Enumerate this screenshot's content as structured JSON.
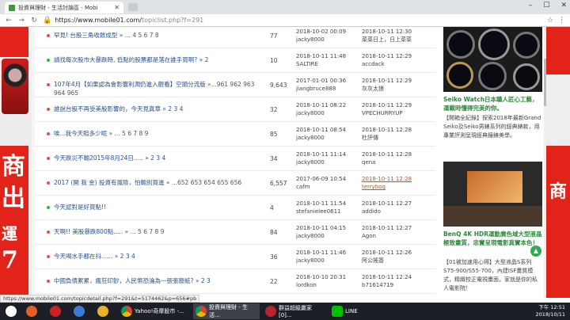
{
  "browser": {
    "tab_title": "投資與理財 - 生活討論區 - Mobi",
    "url_host": "https://www.mobile01.com/",
    "url_path": "topiclist.php?f=291"
  },
  "ad_left_text": [
    "商",
    "出",
    "運",
    "7"
  ],
  "topics": [
    {
      "title": "罕見! 台股三角收斂成型 »",
      "pages": "... 4 5 6 7 8",
      "count": "77",
      "start_date": "2018-10-02 00:09",
      "start_user": "jacky8000",
      "last_date": "2018-10-11 12:30",
      "last_user": "菜菜日上，日上菜菜",
      "dot_color": "#d9534f"
    },
    {
      "title": "請找每次股市大暴跌時, 低點的股票都是落在誰手買啊? » 2",
      "pages": "",
      "count": "10",
      "start_date": "2018-10-11 11:48",
      "start_user": "SALTIRE",
      "last_date": "2018-10-11 12:29",
      "last_user": "accdack",
      "dot_color": "#3fae49"
    },
    {
      "title": "107年4月【如果認為會影響利潤仍進入觀看】空頭分流版",
      "pages": "»...961 962 963 964 965",
      "count": "9,643",
      "start_date": "2017-01-01 00:36",
      "start_user": "jiangbruce888",
      "last_date": "2018-10-11 12:29",
      "last_user": "灰灰太狼",
      "dot_color": "#d9534f"
    },
    {
      "title": "誰說台股不再受美股影響的，今天見真章 » 2 3 4",
      "pages": "",
      "count": "32",
      "start_date": "2018-10-11 08:22",
      "start_user": "jacky8000",
      "last_date": "2018-10-11 12:29",
      "last_user": "VPECHURRYUP",
      "dot_color": "#d9534f"
    },
    {
      "title": "唉...我今天賠多少呢 »",
      "pages": "... 5 6 7 8 9",
      "count": "85",
      "start_date": "2018-10-11 08:54",
      "start_user": "jacky8000",
      "last_date": "2018-10-11 12:28",
      "last_user": "杜評傳",
      "dot_color": "#d9534f"
    },
    {
      "title": "今天跌災不輸2015年8月24日..... » 2 3 4",
      "pages": "",
      "count": "34",
      "start_date": "2018-10-11 11:14",
      "start_user": "jacky8000",
      "last_date": "2018-10-11 12:28",
      "last_user": "qena",
      "dot_color": "#d9534f"
    },
    {
      "title": "2017 (開 我 金) 投資有風險，怕輸別買進 »",
      "pages": "...652 653 654 655 656",
      "count": "6,557",
      "start_date": "2017-06-09 10:54",
      "start_user": "cafm",
      "last_date": "2018-10-11 12:28",
      "last_user": "terrybog",
      "dot_color": "#d9534f",
      "last_link": true
    },
    {
      "title": "今天認對是好買點!!",
      "pages": "",
      "count": "4",
      "start_date": "2018-10-11 11:54",
      "start_user": "stefanielee0611",
      "last_date": "2018-10-11 12:27",
      "last_user": "addido",
      "dot_color": "#3fae49"
    },
    {
      "title": "天啊!! 美股暴跌800點..... »",
      "pages": "... 5 6 7 8 9",
      "count": "84",
      "start_date": "2018-10-11 04:15",
      "start_user": "jacky8000",
      "last_date": "2018-10-11 12:27",
      "last_user": "Agon",
      "dot_color": "#d9534f"
    },
    {
      "title": "今天喝水手都在抖...... » 2 3 4",
      "pages": "",
      "count": "36",
      "start_date": "2018-10-11 11:46",
      "start_user": "jacky8000",
      "last_date": "2018-10-11 12:26",
      "last_user": "阿公搖簽",
      "dot_color": "#d9534f"
    },
    {
      "title": "中國負債累累，瘋狂印鈔，人民幣恐淪為一張張廢紙? » 2 3",
      "pages": "",
      "count": "22",
      "start_date": "2018-10-10 20:31",
      "start_user": "lordkon",
      "last_date": "2018-10-11 12:24",
      "last_user": "b71614719",
      "dot_color": "#d9534f"
    }
  ],
  "sidebar": {
    "ad1_title": "Seiko Watch日本職人匠心工藝，運載時懂得完美的你。",
    "ad1_text": "【開箱全紀錄】探索2018年最新Grand Seiko及Seiko男錶系列的經典錶款，用專業評測呈現經典鐘錶美學。",
    "ad2_title": "BenQ 4K HDR運動廣色域大型液晶 極致畫質，忠實呈現電影真實本色！",
    "ad2_text": "【01被加速用心得】大型液晶S系列S75-900/S55-700，內建ISF畫質模式，精緻校正電視畫面，家就是你的私人電影院！"
  },
  "status_url": "https://www.mobile01.com/topicdetail.php?f=291&t=5174462&p=656#pb",
  "taskbar": {
    "items": [
      {
        "label": "Yahoo!奇摩股市 -..."
      },
      {
        "label": "投資與理財 - 生活..."
      },
      {
        "label": "群益超級贏家[0]..."
      },
      {
        "label": "LINE"
      }
    ],
    "time": "下午 12:51",
    "date": "2018/10/11"
  }
}
